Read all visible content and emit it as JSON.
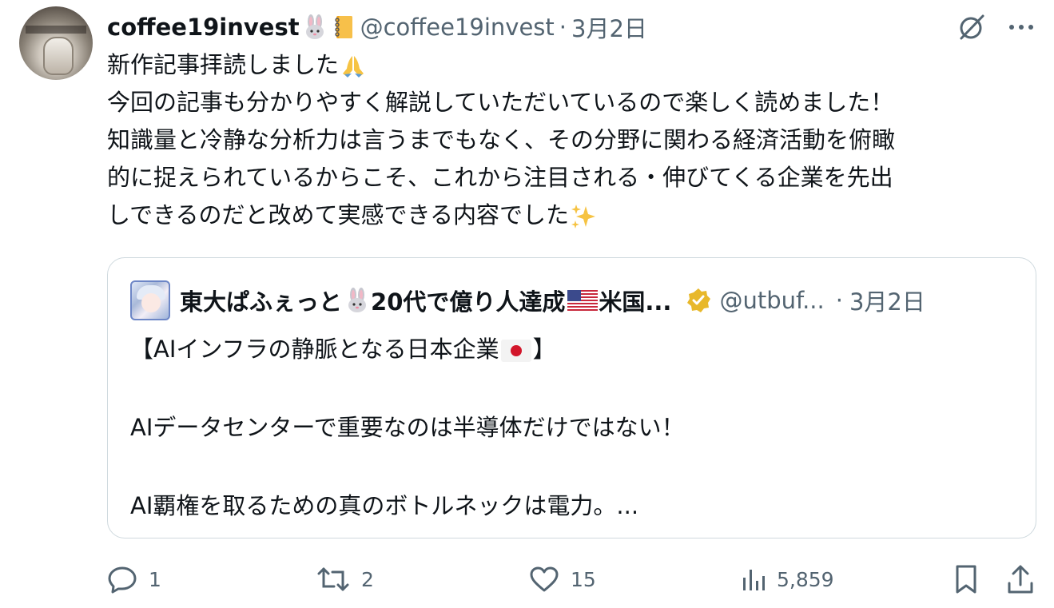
{
  "post": {
    "display_name": "coffee19invest",
    "name_emojis": [
      "rabbit-emoji",
      "notebook-emoji"
    ],
    "handle": "@coffee19invest",
    "separator": "·",
    "date": "3月2日",
    "text_lines": [
      "新作記事拝読しました",
      "今回の記事も分かりやすく解説していただいているので楽しく読めました！",
      "知識量と冷静な分析力は言うまでもなく、その分野に関わる経済活動を俯瞰",
      "的に捉えられているからこそ、これから注目される・伸びてくる企業を先出",
      "しできるのだと改めて実感できる内容でした"
    ]
  },
  "quote": {
    "name_part1": "東大ぱふぇっと",
    "name_part2": "20代で億り人達成",
    "name_part3": "米国...",
    "handle": "@utbuf...",
    "separator": "·",
    "date": "3月2日",
    "line1_start": "【AIインフラの静脈となる日本企業",
    "line1_end": "】",
    "line2": "AIデータセンターで重要なのは半導体だけではない！",
    "line3": "AI覇権を取るための真のボトルネックは電力。..."
  },
  "actions": {
    "reply_count": "1",
    "repost_count": "2",
    "like_count": "15",
    "views_count": "5,859"
  },
  "colors": {
    "text_primary": "#0f1419",
    "text_secondary": "#536471",
    "border": "#cfd9de",
    "verified_gold": "#e8b82a"
  }
}
